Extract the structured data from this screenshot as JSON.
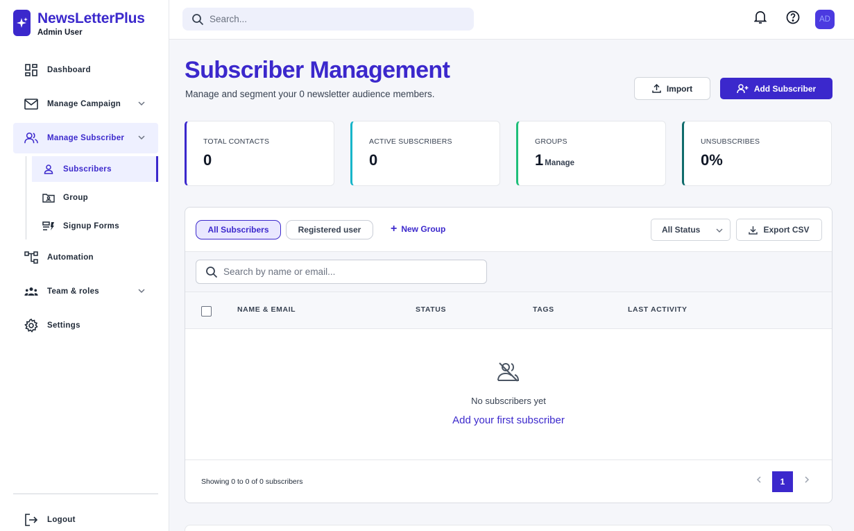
{
  "brand": {
    "name": "NewsLetterPlus",
    "user": "Admin User"
  },
  "sidebar": {
    "items": [
      {
        "label": "Dashboard",
        "icon": "dashboard-icon"
      },
      {
        "label": "Manage Campaign",
        "icon": "mail-icon"
      },
      {
        "label": "Manage Subscriber",
        "icon": "users-icon"
      },
      {
        "label": "Automation",
        "icon": "workflow-icon"
      },
      {
        "label": "Team & roles",
        "icon": "team-icon"
      },
      {
        "label": "Settings",
        "icon": "gear-icon"
      }
    ],
    "sub_items": [
      {
        "label": "Subscribers",
        "icon": "user-icon"
      },
      {
        "label": "Group",
        "icon": "folder-user-icon"
      },
      {
        "label": "Signup Forms",
        "icon": "form-icon"
      }
    ],
    "logout": "Logout"
  },
  "topbar": {
    "search_placeholder": "Search...",
    "avatar_initials": "AD"
  },
  "page": {
    "title": "Subscriber Management",
    "subtitle": "Manage and segment your 0 newsletter audience members.",
    "import_label": "Import",
    "add_label": "Add Subscriber"
  },
  "stats": [
    {
      "label": "TOTAL CONTACTS",
      "value": "0",
      "color": "#3b28cc"
    },
    {
      "label": "ACTIVE SUBSCRIBERS",
      "value": "0",
      "color": "#17b5c9"
    },
    {
      "label": "GROUPS",
      "value": "1",
      "extra": "Manage",
      "color": "#1fbf7a"
    },
    {
      "label": "UNSUBSCRIBES",
      "value": "0%",
      "color": "#0f6b6b"
    }
  ],
  "table": {
    "tabs": [
      "All Subscribers",
      "Registered user"
    ],
    "new_group": "New Group",
    "status_filter": "All Status",
    "export_label": "Export CSV",
    "search_placeholder": "Search by name or email...",
    "columns": [
      "NAME & EMAIL",
      "STATUS",
      "TAGS",
      "LAST ACTIVITY"
    ],
    "empty_message": "No subscribers yet",
    "empty_link": "Add your first subscriber",
    "footer_info": "Showing 0 to 0 of 0 subscribers",
    "current_page": "1"
  },
  "colors": {
    "accent": "#3b28cc",
    "active_bg": "#eef0ff"
  }
}
